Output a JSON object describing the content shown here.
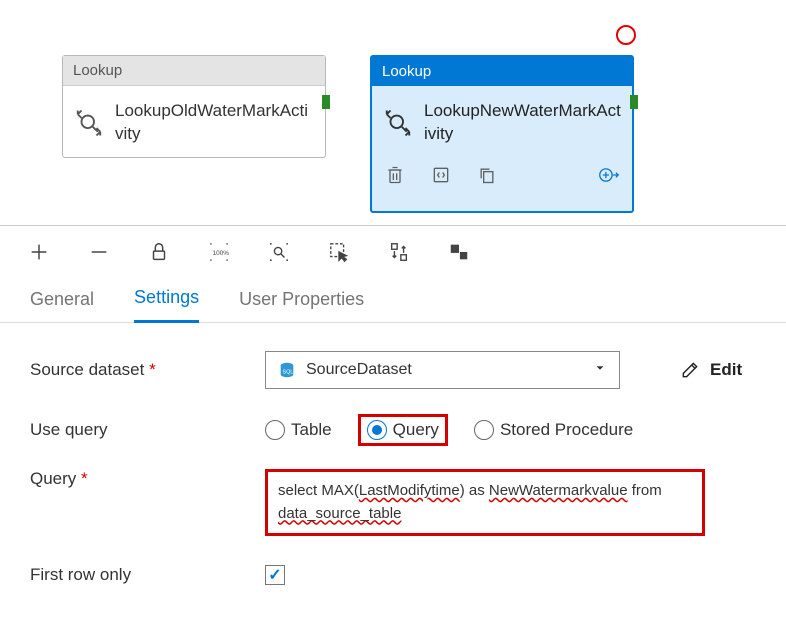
{
  "canvas": {
    "activity1": {
      "type": "Lookup",
      "name": "LookupOldWaterMarkActivity"
    },
    "activity2": {
      "type": "Lookup",
      "name": "LookupNewWaterMarkActivity"
    }
  },
  "tabs": {
    "general": "General",
    "settings": "Settings",
    "userprops": "User Properties"
  },
  "settings": {
    "sourceDatasetLabel": "Source dataset",
    "sourceDatasetValue": "SourceDataset",
    "editLabel": "Edit",
    "useQueryLabel": "Use query",
    "radioTable": "Table",
    "radioQuery": "Query",
    "radioSproc": "Stored Procedure",
    "queryLabel": "Query",
    "queryText1": "select MAX(",
    "querySquiggle1": "LastModifytime",
    "queryText2": ") as ",
    "querySquiggle2": "NewWatermarkvalue",
    "queryText3": " from ",
    "querySquiggle3": "data_source_table",
    "firstRowLabel": "First row only",
    "firstRowChecked": true
  }
}
